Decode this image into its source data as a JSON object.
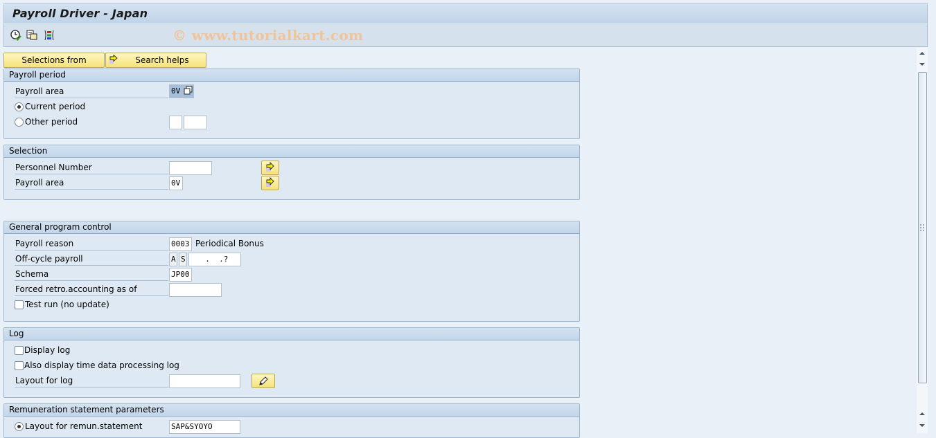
{
  "window": {
    "title": "Payroll Driver - Japan",
    "watermark": "© www.tutorialkart.com"
  },
  "toolbar": {
    "icons": [
      "execute-in-background-icon",
      "get-variant-icon",
      "selection-options-icon"
    ]
  },
  "buttons": {
    "selections_from": "Selections from",
    "search_helps": "Search helps"
  },
  "groups": {
    "payroll_period": {
      "title": "Payroll period",
      "payroll_area_label": "Payroll area",
      "payroll_area_value": "0V",
      "current_period_label": "Current period",
      "current_period_selected": true,
      "other_period_label": "Other period",
      "other_period_selected": false,
      "other_period_value1": "",
      "other_period_value2": ""
    },
    "selection": {
      "title": "Selection",
      "personnel_number_label": "Personnel Number",
      "personnel_number_value": "",
      "payroll_area_label": "Payroll area",
      "payroll_area_value": "0V"
    },
    "general": {
      "title": "General program control",
      "payroll_reason_label": "Payroll reason",
      "payroll_reason_value": "0003",
      "payroll_reason_text": "Periodical Bonus",
      "offcycle_label": "Off-cycle payroll",
      "offcycle_value1": "A",
      "offcycle_value2": "S",
      "offcycle_date": "  .  .?",
      "schema_label": "Schema",
      "schema_value": "JP00",
      "retro_label": "Forced retro.accounting as of",
      "retro_value": "",
      "test_run_label": "Test run (no update)",
      "test_run_checked": false
    },
    "log": {
      "title": "Log",
      "display_log_label": "Display log",
      "display_log_checked": false,
      "time_log_label": "Also display time data processing log",
      "time_log_checked": false,
      "layout_label": "Layout for log",
      "layout_value": ""
    },
    "remuneration": {
      "title": "Remuneration statement parameters",
      "layout_label": "Layout for remun.statement",
      "layout_selected": true,
      "layout_value": "SAP&SYOYO"
    }
  }
}
